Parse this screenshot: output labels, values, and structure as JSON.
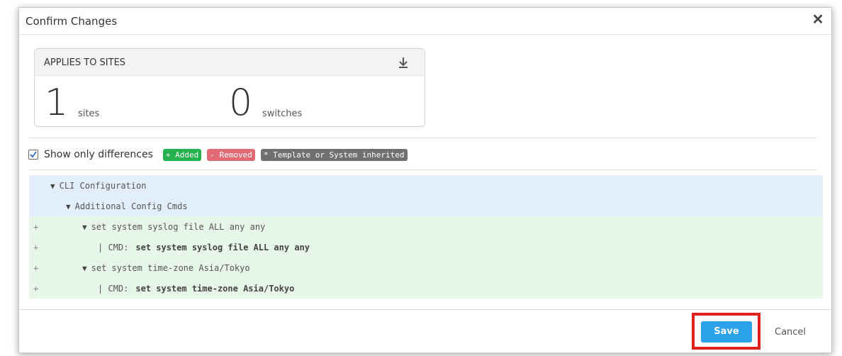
{
  "dialog": {
    "title": "Confirm Changes",
    "close_icon": "close-icon"
  },
  "card": {
    "title": "APPLIES TO SITES",
    "download_icon": "download-icon",
    "sites_count": "1",
    "sites_label": "sites",
    "switches_count": "0",
    "switches_label": "switches"
  },
  "filter": {
    "show_only_differences": "Show only differences",
    "checked": true,
    "badges": [
      {
        "label": "+ Added",
        "color": "#22b14c"
      },
      {
        "label": "- Removed",
        "color": "#e06a76"
      },
      {
        "label": "* Template or System inherited",
        "color": "#707070"
      }
    ]
  },
  "tree": {
    "rows": [
      {
        "sign": "",
        "text": "CLI Configuration",
        "type": "ctx"
      },
      {
        "sign": "",
        "text": "Additional Config Cmds",
        "type": "ctx"
      },
      {
        "sign": "+",
        "text": "set system syslog file ALL any any",
        "type": "add"
      },
      {
        "sign": "+",
        "prefix": "| CMD:",
        "value": "set system syslog file ALL any any",
        "type": "add"
      },
      {
        "sign": "+",
        "text": "set system time-zone Asia/Tokyo",
        "type": "add"
      },
      {
        "sign": "+",
        "prefix": "| CMD:",
        "value": "set system time-zone Asia/Tokyo",
        "type": "add"
      }
    ],
    "triangle": "▼"
  },
  "footer": {
    "save_label": "Save",
    "cancel_label": "Cancel"
  },
  "colors": {
    "accent": "#2aa1e8",
    "highlight": "#e0201b",
    "context_bg": "#e3eefb",
    "added_bg": "#e6f6e8"
  }
}
